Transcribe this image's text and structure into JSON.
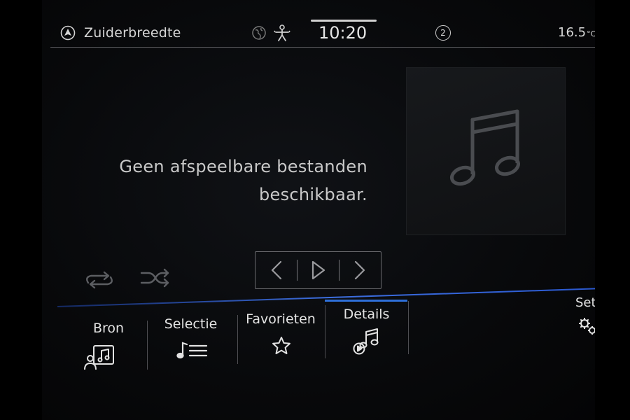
{
  "status": {
    "navigation_label": "Zuiderbreedte",
    "time": "10:20",
    "badge_count": "2",
    "temperature": "16.5",
    "temperature_unit": "°C"
  },
  "player": {
    "message_line1": "Geen afspeelbare bestanden",
    "message_line2": "beschikbaar."
  },
  "menu": {
    "items": [
      {
        "label": "Bron",
        "icon": "source-music-icon"
      },
      {
        "label": "Selectie",
        "icon": "playlist-icon"
      },
      {
        "label": "Favorieten",
        "icon": "star-icon"
      },
      {
        "label": "Details",
        "icon": "play-note-icon",
        "active": true
      }
    ],
    "settings_label": "Set"
  },
  "colors": {
    "accent": "#2e6fd8",
    "text": "#d8d8d8",
    "background": "#08090b"
  }
}
